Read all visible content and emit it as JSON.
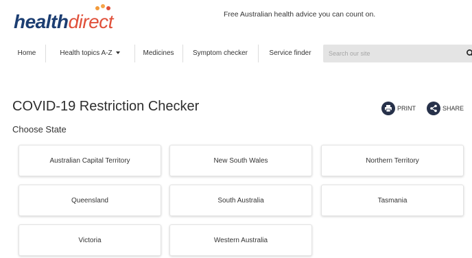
{
  "header": {
    "logo_part1": "health",
    "logo_part2": "direct",
    "tagline": "Free Australian health advice you can count on."
  },
  "nav": {
    "items": [
      {
        "label": "Home"
      },
      {
        "label": "Health topics A-Z"
      },
      {
        "label": "Medicines"
      },
      {
        "label": "Symptom checker"
      },
      {
        "label": "Service finder"
      }
    ],
    "search_placeholder": "Search our site"
  },
  "page": {
    "title": "COVID-19 Restriction Checker",
    "print_label": "PRINT",
    "share_label": "SHARE",
    "subtitle": "Choose State"
  },
  "states": [
    {
      "label": "Australian Capital Territory"
    },
    {
      "label": "New South Wales"
    },
    {
      "label": "Northern Territory"
    },
    {
      "label": "Queensland"
    },
    {
      "label": "South Australia"
    },
    {
      "label": "Tasmania"
    },
    {
      "label": "Victoria"
    },
    {
      "label": "Western Australia"
    }
  ],
  "colors": {
    "brand_navy": "#1c3e72",
    "brand_red": "#e0503a",
    "icon_dark": "#27314a"
  },
  "icons": {
    "search": "search-icon",
    "print": "print-icon",
    "share": "share-icon",
    "dropdown": "chevron-down-icon"
  }
}
